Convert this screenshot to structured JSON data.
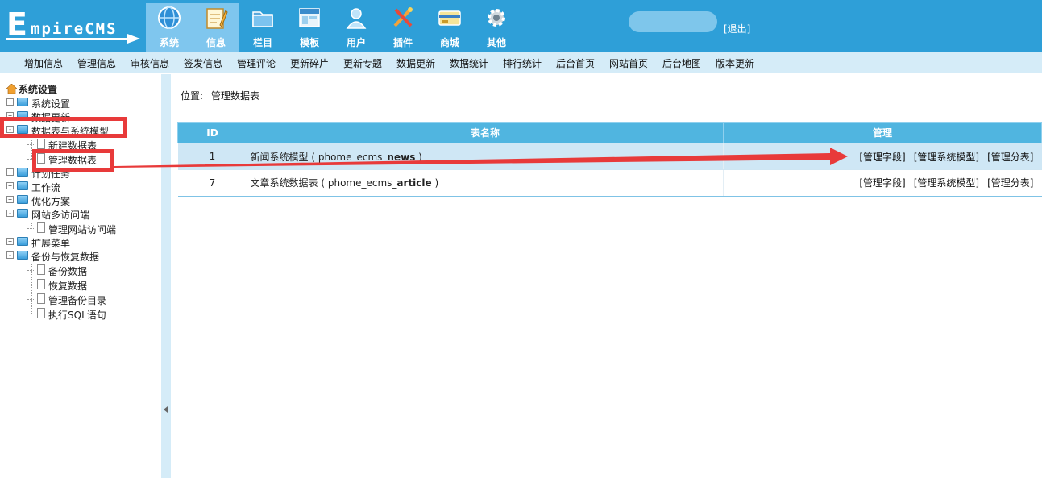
{
  "logo": {
    "letter": "E",
    "rest": "mpireCMS"
  },
  "nav": [
    {
      "label": "系统",
      "icon": "globe-icon",
      "active": true
    },
    {
      "label": "信息",
      "icon": "notepad-icon",
      "active": true
    },
    {
      "label": "栏目",
      "icon": "folder-icon"
    },
    {
      "label": "模板",
      "icon": "window-icon"
    },
    {
      "label": "用户",
      "icon": "user-icon"
    },
    {
      "label": "插件",
      "icon": "tools-icon"
    },
    {
      "label": "商城",
      "icon": "card-icon"
    },
    {
      "label": "其他",
      "icon": "gear-icon"
    }
  ],
  "logout": "[退出]",
  "submenu": [
    "增加信息",
    "管理信息",
    "审核信息",
    "签发信息",
    "管理评论",
    "更新碎片",
    "更新专题",
    "数据更新",
    "数据统计",
    "排行统计",
    "后台首页",
    "网站首页",
    "后台地图",
    "版本更新"
  ],
  "sidebar": {
    "root": "系统设置",
    "items": [
      {
        "label": "系统设置",
        "expanded": false
      },
      {
        "label": "数据更新",
        "expanded": false
      },
      {
        "label": "数据表与系统模型",
        "expanded": true
      },
      {
        "label": "新建数据表"
      },
      {
        "label": "管理数据表"
      },
      {
        "label": "计划任务",
        "expanded": false
      },
      {
        "label": "工作流",
        "expanded": false
      },
      {
        "label": "优化方案",
        "expanded": false
      },
      {
        "label": "网站多访问端",
        "expanded": true
      },
      {
        "label": "管理网站访问端"
      },
      {
        "label": "扩展菜单",
        "expanded": false
      },
      {
        "label": "备份与恢复数据",
        "expanded": true
      },
      {
        "label": "备份数据"
      },
      {
        "label": "恢复数据"
      },
      {
        "label": "管理备份目录"
      },
      {
        "label": "执行SQL语句"
      }
    ]
  },
  "location": {
    "label": "位置:",
    "link": "管理数据表"
  },
  "table": {
    "headers": [
      "ID",
      "表名称",
      "管理"
    ],
    "rows": [
      {
        "id": "1",
        "name": "新闻系统模型",
        "table_prefix": "phome_ecms_",
        "table_suffix": "news"
      },
      {
        "id": "7",
        "name": "文章系统数据表",
        "table_prefix": "phome_ecms_",
        "table_suffix": "article"
      }
    ],
    "actions": [
      "[管理字段]",
      "[管理系统模型]",
      "[管理分表]"
    ],
    "paren_open": "(",
    "paren_close": ")"
  },
  "colors": {
    "header": "#2e9fd8",
    "submenu": "#d5ecf8",
    "table_header": "#50b5e0",
    "annotation": "#e83a3a"
  }
}
